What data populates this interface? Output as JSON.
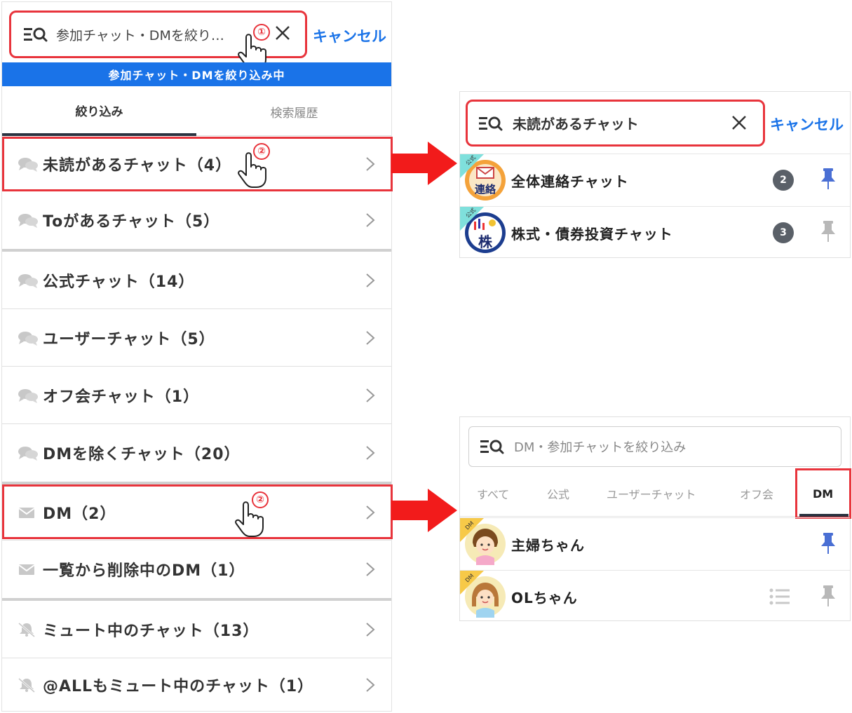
{
  "left_panel": {
    "search_text": "参加チャット・DMを絞り…",
    "cancel_label": "キャンセル",
    "marker_1": "①",
    "marker_2": "②",
    "banner": "参加チャット・DMを絞り込み中",
    "tabs": [
      {
        "label": "絞り込み",
        "active": true
      },
      {
        "label": "検索履歴",
        "active": false
      }
    ],
    "filters": [
      {
        "label": "未読があるチャット（4）",
        "icon": "chat-bubbles-icon",
        "highlighted": true
      },
      {
        "label": "Toがあるチャット（5）",
        "icon": "chat-bubbles-icon"
      },
      {
        "label": "公式チャット（14）",
        "icon": "chat-bubbles-icon"
      },
      {
        "label": "ユーザーチャット（5）",
        "icon": "chat-bubbles-icon"
      },
      {
        "label": "オフ会チャット（1）",
        "icon": "chat-bubbles-icon"
      },
      {
        "label": "DMを除くチャット（20）",
        "icon": "chat-bubbles-icon"
      },
      {
        "label": "DM（2）",
        "icon": "envelope-icon",
        "highlighted": true
      },
      {
        "label": "一覧から削除中のDM（1）",
        "icon": "envelope-icon"
      },
      {
        "label": "ミュート中のチャット（13）",
        "icon": "muted-bell-icon"
      },
      {
        "label": "@ALLもミュート中のチャット（1）",
        "icon": "muted-bell-icon"
      }
    ]
  },
  "right_top": {
    "search_text": "未読があるチャット",
    "cancel_label": "キャンセル",
    "chats": [
      {
        "name": "全体連絡チャット",
        "unread": "2",
        "pinned": true,
        "avatar_text": "連絡",
        "tag": "公式"
      },
      {
        "name": "株式・債券投資チャット",
        "unread": "3",
        "pinned": false,
        "avatar_text": "株",
        "tag": "公式"
      }
    ]
  },
  "right_bottom": {
    "search_placeholder": "DM・参加チャットを絞り込み",
    "tabs": [
      {
        "label": "すべて"
      },
      {
        "label": "公式"
      },
      {
        "label": "ユーザーチャット"
      },
      {
        "label": "オフ会"
      },
      {
        "label": "DM",
        "active": true
      }
    ],
    "dms": [
      {
        "name": "主婦ちゃん",
        "pinned": true,
        "tag": "DM"
      },
      {
        "name": "OLちゃん",
        "pinned": false,
        "tag": "DM"
      }
    ]
  },
  "colors": {
    "accent_blue": "#1a73e8",
    "highlight_red": "#e8343c",
    "pin_active": "#4a6fd4",
    "pin_inactive": "#b8b8b8"
  }
}
